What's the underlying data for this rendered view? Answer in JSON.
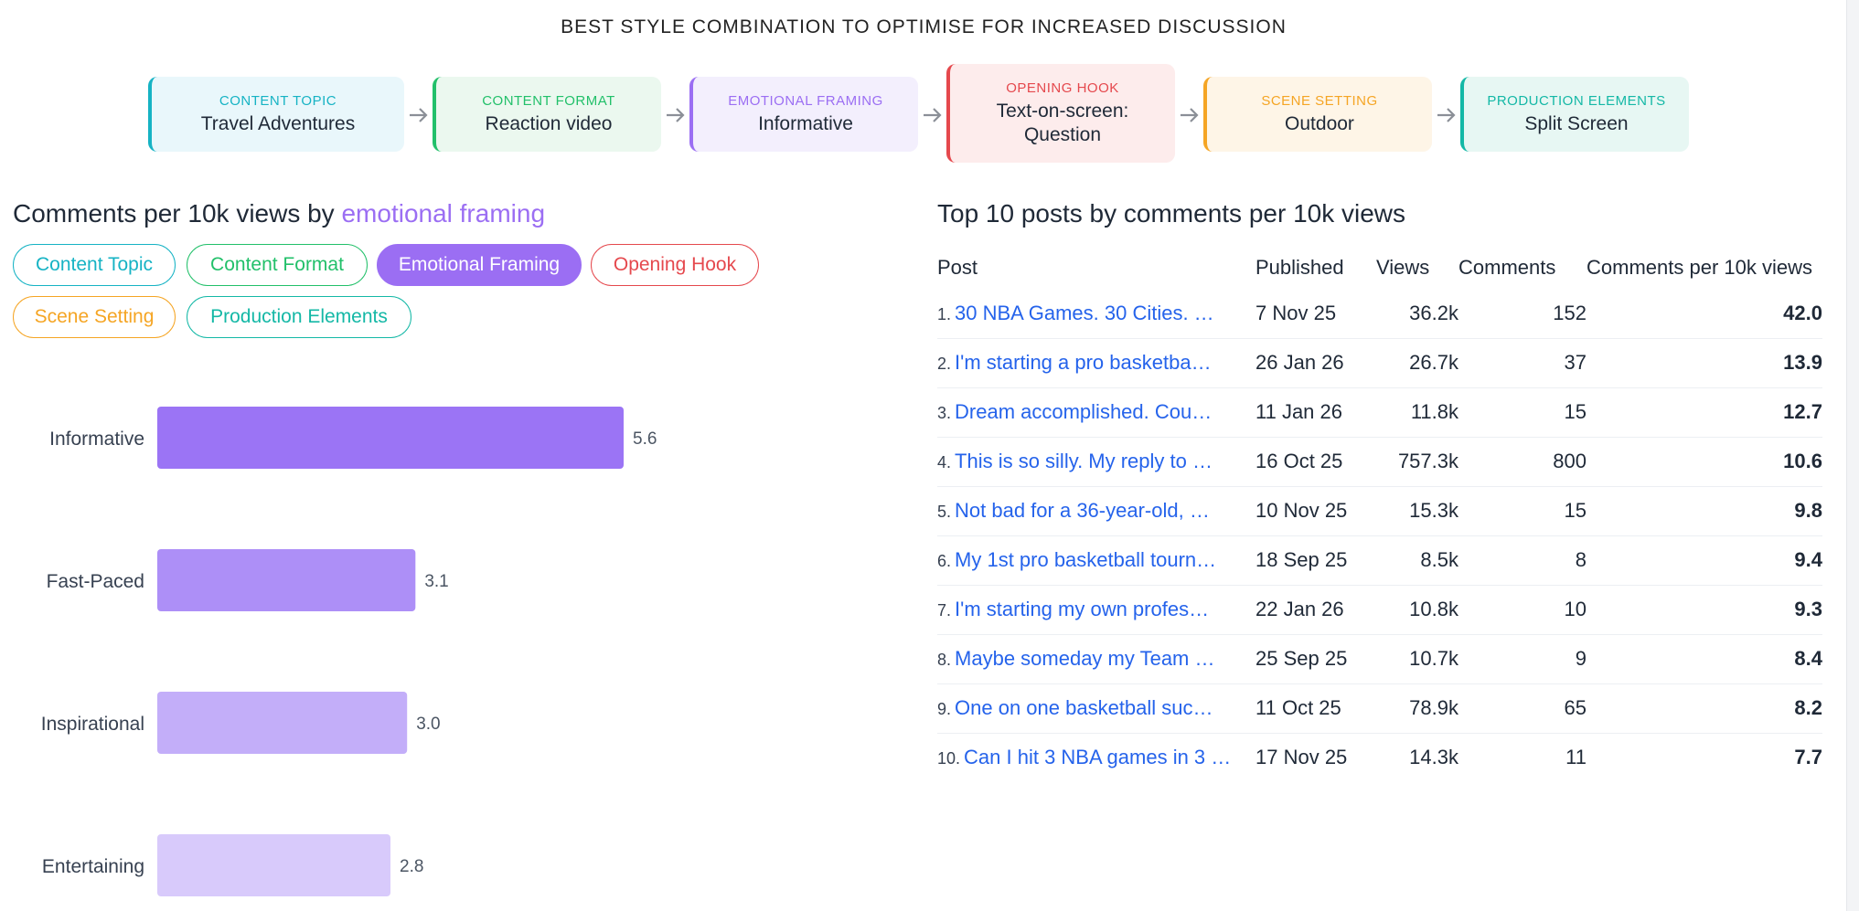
{
  "page_title": "BEST STYLE COMBINATION TO OPTIMISE FOR INCREASED DISCUSSION",
  "steps": [
    {
      "label": "CONTENT TOPIC",
      "value": "Travel Adventures",
      "color": "#16b3c4",
      "bg": "#e9f7fb"
    },
    {
      "label": "CONTENT FORMAT",
      "value": "Reaction video",
      "color": "#22c06a",
      "bg": "#ebf8ef"
    },
    {
      "label": "EMOTIONAL FRAMING",
      "value": "Informative",
      "color": "#9b6ef3",
      "bg": "#f3effd"
    },
    {
      "label": "OPENING HOOK",
      "value": "Text-on-screen: Question",
      "color": "#e5484d",
      "bg": "#fdecec"
    },
    {
      "label": "SCENE SETTING",
      "value": "Outdoor",
      "color": "#f5a524",
      "bg": "#fef5e7"
    },
    {
      "label": "PRODUCTION ELEMENTS",
      "value": "Split Screen",
      "color": "#14b8a6",
      "bg": "#e7f7f3"
    }
  ],
  "left_panel": {
    "title_prefix": "Comments per 10k views by ",
    "title_highlight": "emotional framing",
    "chips": [
      {
        "label": "Content Topic",
        "color": "#16b3c4",
        "active": false
      },
      {
        "label": "Content Format",
        "color": "#22c06a",
        "active": false
      },
      {
        "label": "Emotional Framing",
        "color": "#9b6ef3",
        "active": true
      },
      {
        "label": "Opening Hook",
        "color": "#e5484d",
        "active": false
      },
      {
        "label": "Scene Setting",
        "color": "#f5a524",
        "active": false
      },
      {
        "label": "Production Elements",
        "color": "#14b8a6",
        "active": false
      }
    ]
  },
  "chart_data": {
    "type": "bar",
    "orientation": "horizontal",
    "categories": [
      "Informative",
      "Fast-Paced",
      "Inspirational",
      "Entertaining"
    ],
    "values": [
      5.6,
      3.1,
      3.0,
      2.8
    ],
    "value_labels": [
      "5.6",
      "3.1",
      "3.0",
      "2.8"
    ],
    "colors": [
      "#9b74f5",
      "#ad8ff7",
      "#c3aef9",
      "#d8cafb"
    ],
    "xlim": [
      0,
      8
    ]
  },
  "right_panel": {
    "title": "Top 10 posts by comments per 10k views",
    "columns": [
      "Post",
      "Published",
      "Views",
      "Comments",
      "Comments per 10k views"
    ],
    "rows": [
      {
        "rank": "1.",
        "post": "30 NBA Games. 30 Cities. …",
        "published": "7 Nov 25",
        "views": "36.2k",
        "comments": "152",
        "cpv": "42.0"
      },
      {
        "rank": "2.",
        "post": "I'm starting a pro basketba…",
        "published": "26 Jan 26",
        "views": "26.7k",
        "comments": "37",
        "cpv": "13.9"
      },
      {
        "rank": "3.",
        "post": "Dream accomplished. Cou…",
        "published": "11 Jan 26",
        "views": "11.8k",
        "comments": "15",
        "cpv": "12.7"
      },
      {
        "rank": "4.",
        "post": "This is so silly. My reply to @…",
        "published": "16 Oct 25",
        "views": "757.3k",
        "comments": "800",
        "cpv": "10.6"
      },
      {
        "rank": "5.",
        "post": "Not bad for a 36-year-old, …",
        "published": "10 Nov 25",
        "views": "15.3k",
        "comments": "15",
        "cpv": "9.8"
      },
      {
        "rank": "6.",
        "post": "My 1st pro basketball tourn…",
        "published": "18 Sep 25",
        "views": "8.5k",
        "comments": "8",
        "cpv": "9.4"
      },
      {
        "rank": "7.",
        "post": "I'm starting my own profes…",
        "published": "22 Jan 26",
        "views": "10.8k",
        "comments": "10",
        "cpv": "9.3"
      },
      {
        "rank": "8.",
        "post": "Maybe someday my Team …",
        "published": "25 Sep 25",
        "views": "10.7k",
        "comments": "9",
        "cpv": "8.4"
      },
      {
        "rank": "9.",
        "post": "One on one basketball suc…",
        "published": "11 Oct 25",
        "views": "78.9k",
        "comments": "65",
        "cpv": "8.2"
      },
      {
        "rank": "10.",
        "post": "Can I hit 3 NBA games in 3 …",
        "published": "17 Nov 25",
        "views": "14.3k",
        "comments": "11",
        "cpv": "7.7"
      }
    ]
  }
}
